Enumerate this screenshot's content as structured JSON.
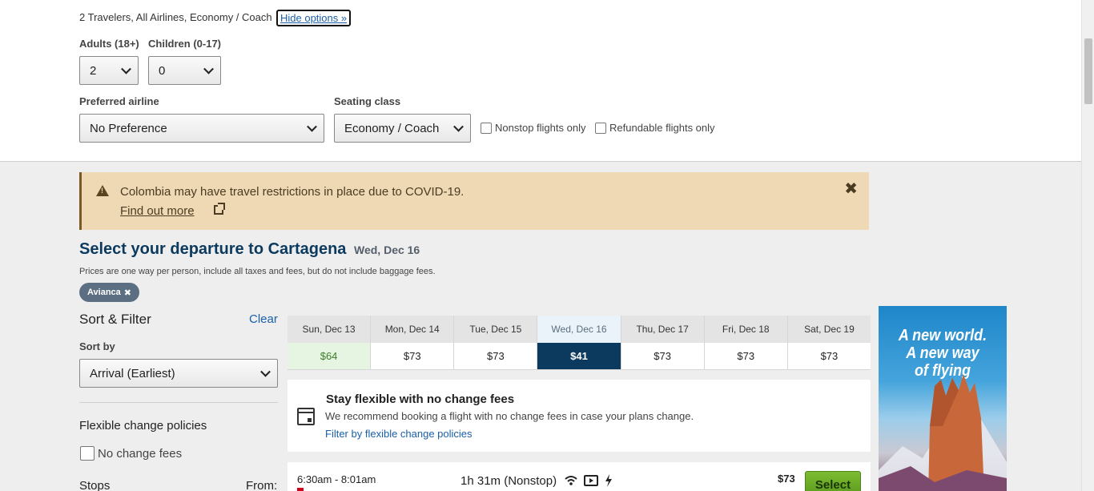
{
  "search_options": {
    "summary": "2 Travelers, All Airlines, Economy / Coach",
    "hide_options_label": "Hide options »",
    "adults_label": "Adults (18+)",
    "adults_value": "2",
    "children_label": "Children (0-17)",
    "children_value": "0",
    "airline_label": "Preferred airline",
    "airline_value": "No Preference",
    "seating_label": "Seating class",
    "seating_value": "Economy / Coach",
    "nonstop_label": "Nonstop flights only",
    "nonstop_checked": false,
    "refundable_label": "Refundable flights only",
    "refundable_checked": false
  },
  "alert": {
    "message": "Colombia may have travel restrictions in place due to COVID-19.",
    "link": "Find out more",
    "close": "✖"
  },
  "results_header": {
    "title": "Select your departure to Cartagena",
    "date": "Wed, Dec 16",
    "note": "Prices are one way per person, include all taxes and fees, but do not include baggage fees.",
    "filter_chip": "Avianca",
    "filter_chip_remove": "✖"
  },
  "sidebar": {
    "title": "Sort & Filter",
    "clear": "Clear",
    "sort_label": "Sort by",
    "sort_value": "Arrival (Earliest)",
    "flex_title": "Flexible change policies",
    "no_change_label": "No change fees",
    "stops_label": "Stops",
    "from_label": "From:"
  },
  "date_bar": [
    {
      "day": "Sun, Dec 13",
      "price": "$64",
      "state": "cheapest"
    },
    {
      "day": "Mon, Dec 14",
      "price": "$73",
      "state": "normal"
    },
    {
      "day": "Tue, Dec 15",
      "price": "$73",
      "state": "normal"
    },
    {
      "day": "Wed, Dec 16",
      "price": "$41",
      "state": "selected"
    },
    {
      "day": "Thu, Dec 17",
      "price": "$73",
      "state": "normal"
    },
    {
      "day": "Fri, Dec 18",
      "price": "$73",
      "state": "normal"
    },
    {
      "day": "Sat, Dec 19",
      "price": "$73",
      "state": "normal"
    }
  ],
  "flex_card": {
    "title": "Stay flexible with no change fees",
    "subtitle": "We recommend booking a flight with no change fees in case your plans change.",
    "link": "Filter by flexible change policies"
  },
  "flight": {
    "times": "6:30am - 8:01am",
    "duration": "1h 31m (Nonstop)",
    "amenities": [
      "wifi-icon",
      "video-icon",
      "power-icon"
    ],
    "price": "$73",
    "select_label": "Select"
  },
  "ad": {
    "lines": [
      "A new world.",
      "A new way",
      "of flying"
    ]
  },
  "colors": {
    "navy": "#0b3a5e",
    "link": "#1a5fa8",
    "alert_bg": "#efd9b4",
    "select_green": "#6aab27",
    "cheap_green": "#3e7c2c"
  }
}
